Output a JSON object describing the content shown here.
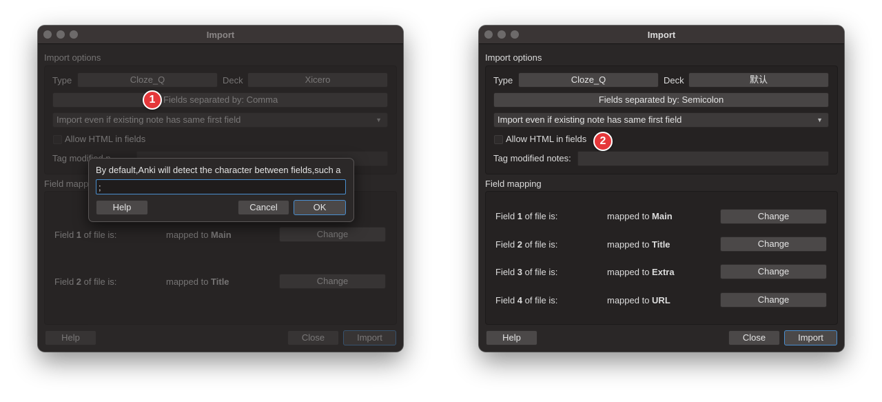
{
  "left_window": {
    "title": "Import",
    "import_options_label": "Import options",
    "type_label": "Type",
    "type_value": "Cloze_Q",
    "deck_label": "Deck",
    "deck_value": "Xicero",
    "separator_button": "Fields separated by: Comma",
    "duplicate_option": "Import even if existing note has same first field",
    "allow_html_label": "Allow HTML in fields",
    "tag_modified_label": "Tag modified n",
    "field_mapping_label": "Field mapp",
    "mappings": [
      {
        "field_prefix": "Field ",
        "field_num": "1",
        "field_suffix": " of file is:",
        "mapped_prefix": "mapped to ",
        "mapped_target": "Main",
        "change_label": "Change"
      },
      {
        "field_prefix": "Field ",
        "field_num": "2",
        "field_suffix": " of file is:",
        "mapped_prefix": "mapped to ",
        "mapped_target": "Title",
        "change_label": "Change"
      }
    ],
    "help_label": "Help",
    "close_label": "Close",
    "import_label": "Import",
    "badge": "1"
  },
  "popup": {
    "message": "By default,Anki will detect the character between fields,such a",
    "input_value": ";",
    "help_label": "Help",
    "cancel_label": "Cancel",
    "ok_label": "OK"
  },
  "right_window": {
    "title": "Import",
    "import_options_label": "Import options",
    "type_label": "Type",
    "type_value": "Cloze_Q",
    "deck_label": "Deck",
    "deck_value": "默认",
    "separator_button": "Fields separated by: Semicolon",
    "duplicate_option": "Import even if existing note has same first field",
    "allow_html_label": "Allow HTML in fields",
    "tag_modified_label": "Tag modified notes:",
    "field_mapping_label": "Field mapping",
    "mappings": [
      {
        "field_prefix": "Field ",
        "field_num": "1",
        "field_suffix": " of file is:",
        "mapped_prefix": "mapped to ",
        "mapped_target": "Main",
        "change_label": "Change"
      },
      {
        "field_prefix": "Field ",
        "field_num": "2",
        "field_suffix": " of file is:",
        "mapped_prefix": "mapped to ",
        "mapped_target": "Title",
        "change_label": "Change"
      },
      {
        "field_prefix": "Field ",
        "field_num": "3",
        "field_suffix": " of file is:",
        "mapped_prefix": "mapped to ",
        "mapped_target": "Extra",
        "change_label": "Change"
      },
      {
        "field_prefix": "Field ",
        "field_num": "4",
        "field_suffix": " of file is:",
        "mapped_prefix": "mapped to ",
        "mapped_target": "URL",
        "change_label": "Change"
      }
    ],
    "help_label": "Help",
    "close_label": "Close",
    "import_label": "Import",
    "badge": "2"
  },
  "colors": {
    "window_bg": "#2a2727",
    "titlebar_bg": "#3a3535",
    "badge_red": "#e5373a",
    "focus_blue": "#4a8fd0"
  }
}
